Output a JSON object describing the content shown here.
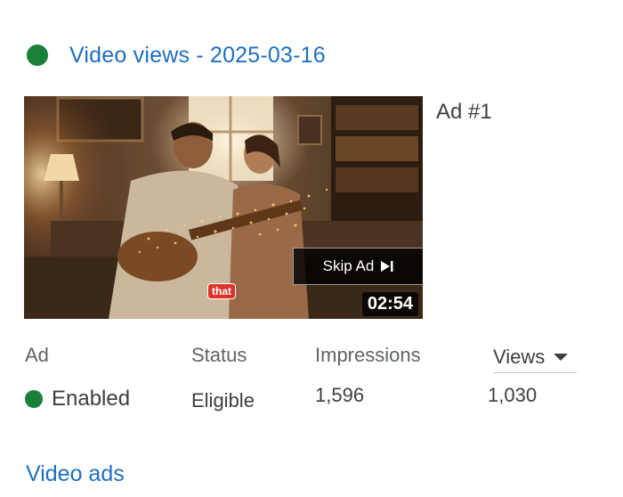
{
  "header": {
    "title": "Video views - 2025-03-16",
    "status_color": "#188038"
  },
  "ad_card": {
    "ad_number": "Ad #1",
    "thumbnail": {
      "skip_label": "Skip Ad",
      "skip_icon": "skip-next-icon",
      "caption_word": "that",
      "duration": "02:54"
    }
  },
  "table": {
    "columns": {
      "ad": "Ad",
      "status": "Status",
      "impressions": "Impressions",
      "views": "Views"
    },
    "sort_icon": "arrow-drop-down-icon",
    "row": {
      "ad_state": "Enabled",
      "status": "Eligible",
      "impressions": "1,596",
      "views": "1,030"
    }
  },
  "footer": {
    "link_label": "Video ads"
  },
  "colors": {
    "link": "#1f6fbf",
    "enabled": "#188038"
  }
}
